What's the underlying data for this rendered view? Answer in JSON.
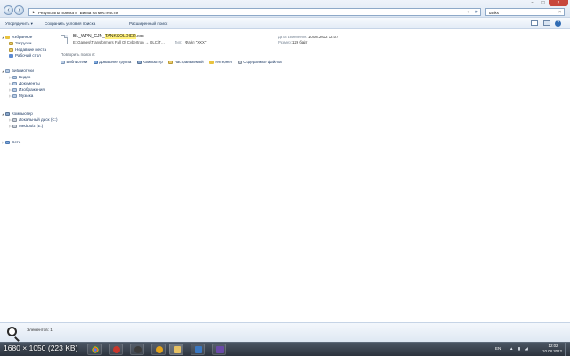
{
  "address_bar": {
    "path": "Результаты поиска в \"Битва на местности\"",
    "search_value": "tanks"
  },
  "command_bar": {
    "organize": "Упорядочить ▾",
    "save_search": "Сохранить условия поиска",
    "advanced_search": "Расширенный поиск"
  },
  "nav": {
    "favorites_header": "Избранное",
    "favorites": [
      "Загрузки",
      "Недавние места",
      "Рабочий стол"
    ],
    "libraries_header": "Библиотеки",
    "libraries": [
      "Видео",
      "Документы",
      "Изображения",
      "Музыка"
    ],
    "computer_header": "Компьютер",
    "drives": [
      "Локальный диск (C:)",
      "Medtoolz (E:)"
    ],
    "network": "Сеть"
  },
  "result": {
    "name_prefix": "BL_WPN_CJN_",
    "name_highlight": "TANKSOLDIER",
    "name_suffix": ".xxx",
    "path": "E:\\Games\\Transformers Fall Of Cybertron → DLC\\T…",
    "type_label": "Тип:",
    "type": "Файл \"XXX\"",
    "date_label": "Дата изменения:",
    "date": "10.08.2012 12:07",
    "size_label": "Размер:",
    "size": "129 байт"
  },
  "search_again": {
    "label": "Повторить поиск в:",
    "items": [
      "Библиотеки",
      "Домашняя группа",
      "Компьютер",
      "Настраиваемый",
      "Интернет",
      "Содержимое файлов"
    ]
  },
  "details": {
    "count_text": "Элементов: 1"
  },
  "overlay": {
    "image_info": "1680 × 1050 (223 KB)"
  },
  "taskbar": {
    "lang": "EN",
    "clock_time": "12:02",
    "clock_date": "10.08.2012"
  }
}
